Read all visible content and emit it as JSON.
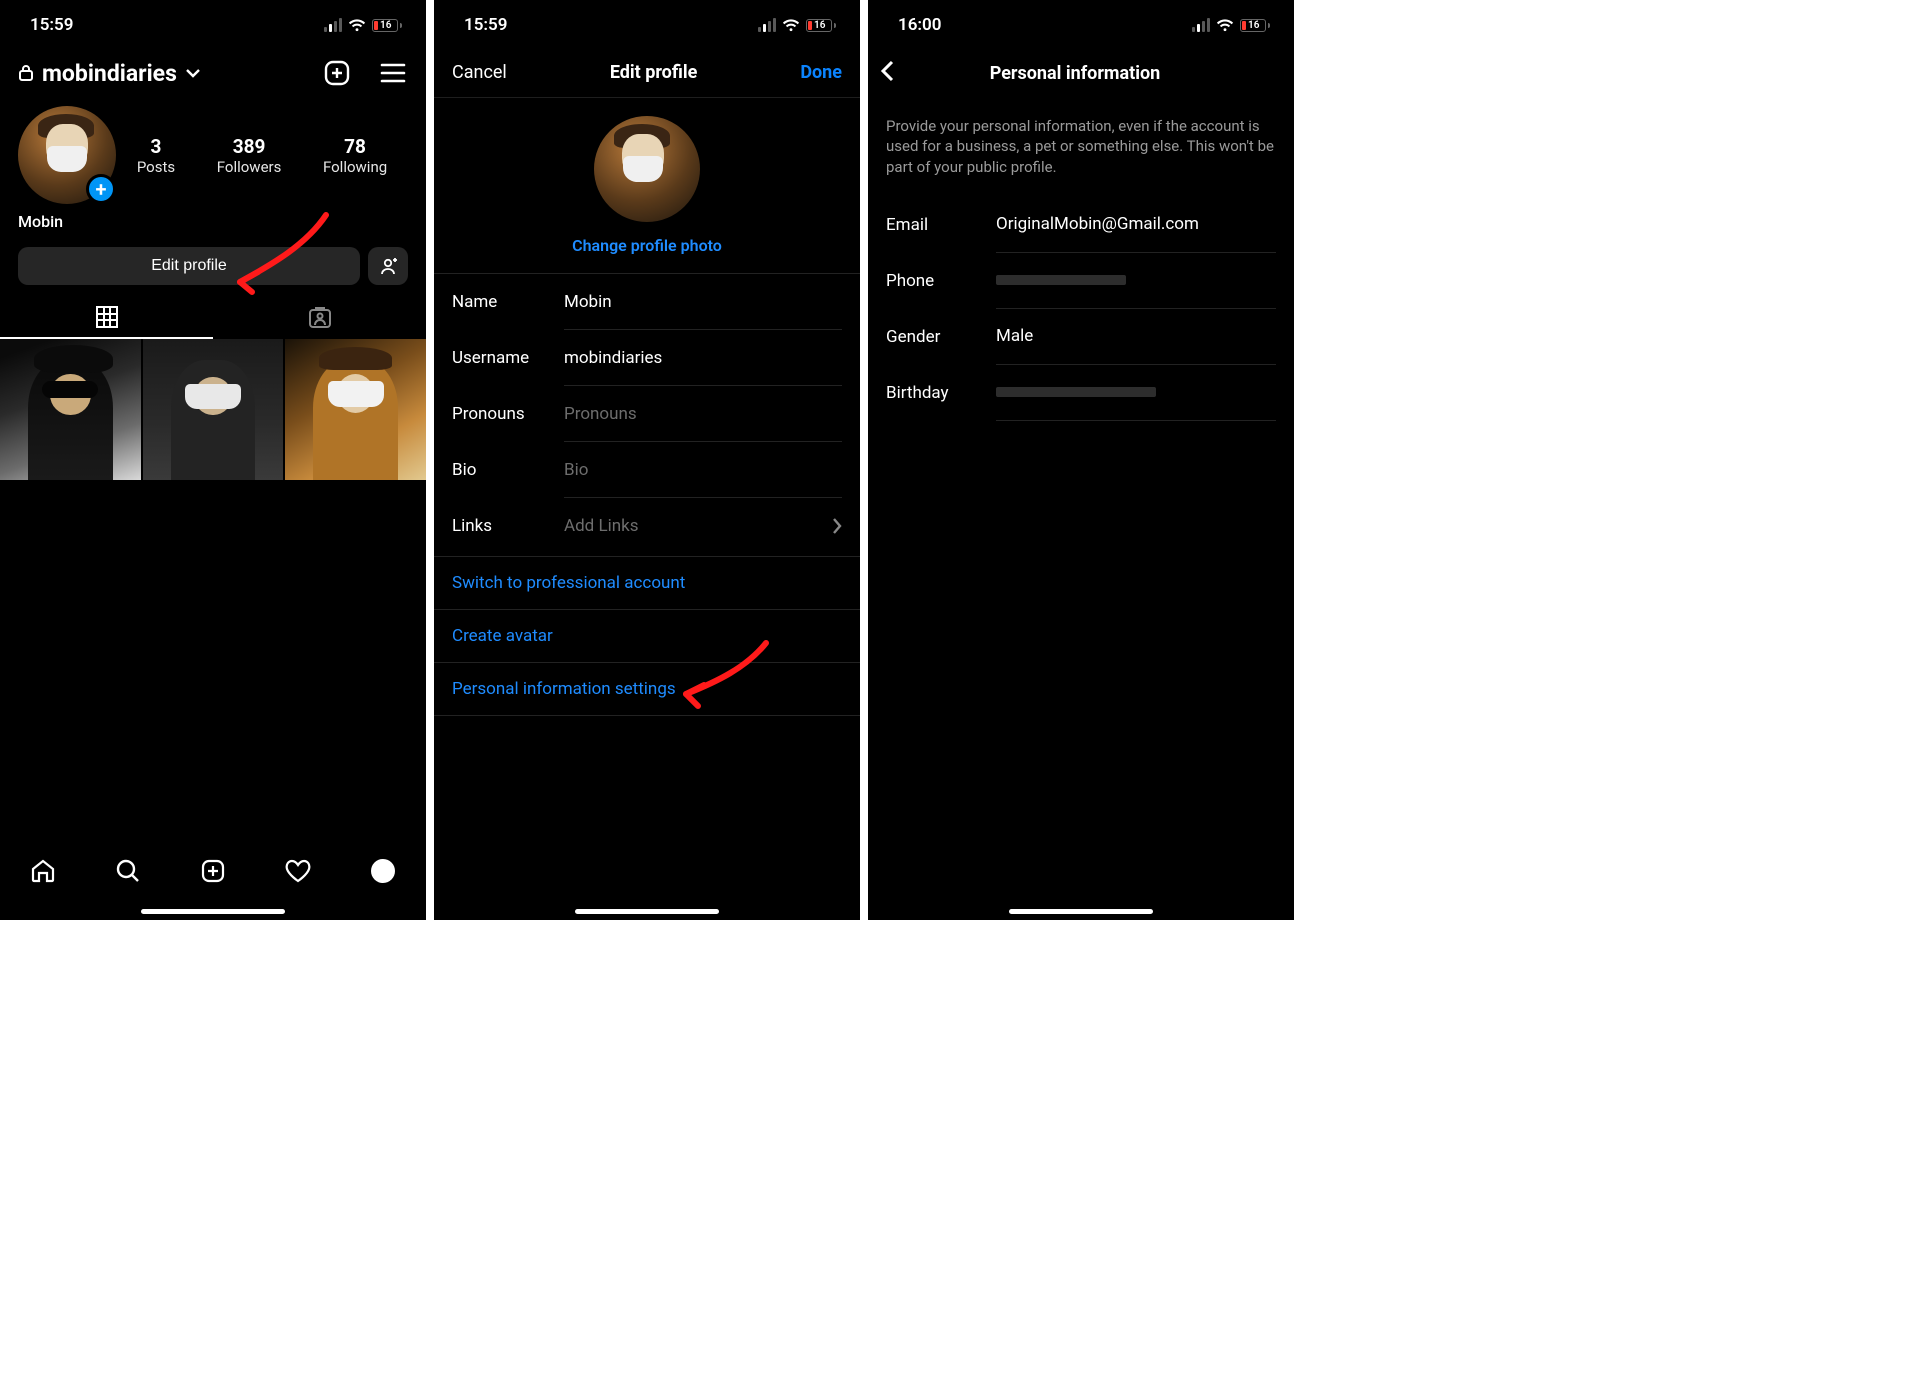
{
  "status": {
    "time1": "15:59",
    "time2": "15:59",
    "time3": "16:00",
    "battery": "16"
  },
  "screen1": {
    "username": "mobindiaries",
    "displayName": "Mobin",
    "posts": {
      "count": "3",
      "label": "Posts"
    },
    "followers": {
      "count": "389",
      "label": "Followers"
    },
    "following": {
      "count": "78",
      "label": "Following"
    },
    "editProfile": "Edit profile"
  },
  "screen2": {
    "cancel": "Cancel",
    "title": "Edit profile",
    "done": "Done",
    "changePhoto": "Change profile photo",
    "fields": {
      "name": {
        "label": "Name",
        "value": "Mobin"
      },
      "username": {
        "label": "Username",
        "value": "mobindiaries"
      },
      "pronouns": {
        "label": "Pronouns",
        "placeholder": "Pronouns"
      },
      "bio": {
        "label": "Bio",
        "placeholder": "Bio"
      },
      "links": {
        "label": "Links",
        "placeholder": "Add Links"
      }
    },
    "switchPro": "Switch to professional account",
    "createAvatar": "Create avatar",
    "personalInfo": "Personal information settings"
  },
  "screen3": {
    "title": "Personal information",
    "intro": "Provide your personal information, even if the account is used for a business, a pet or something else. This won't be part of your public profile.",
    "email": {
      "label": "Email",
      "value": "OriginalMobin@Gmail.com"
    },
    "phone": {
      "label": "Phone"
    },
    "gender": {
      "label": "Gender",
      "value": "Male"
    },
    "birthday": {
      "label": "Birthday"
    }
  }
}
